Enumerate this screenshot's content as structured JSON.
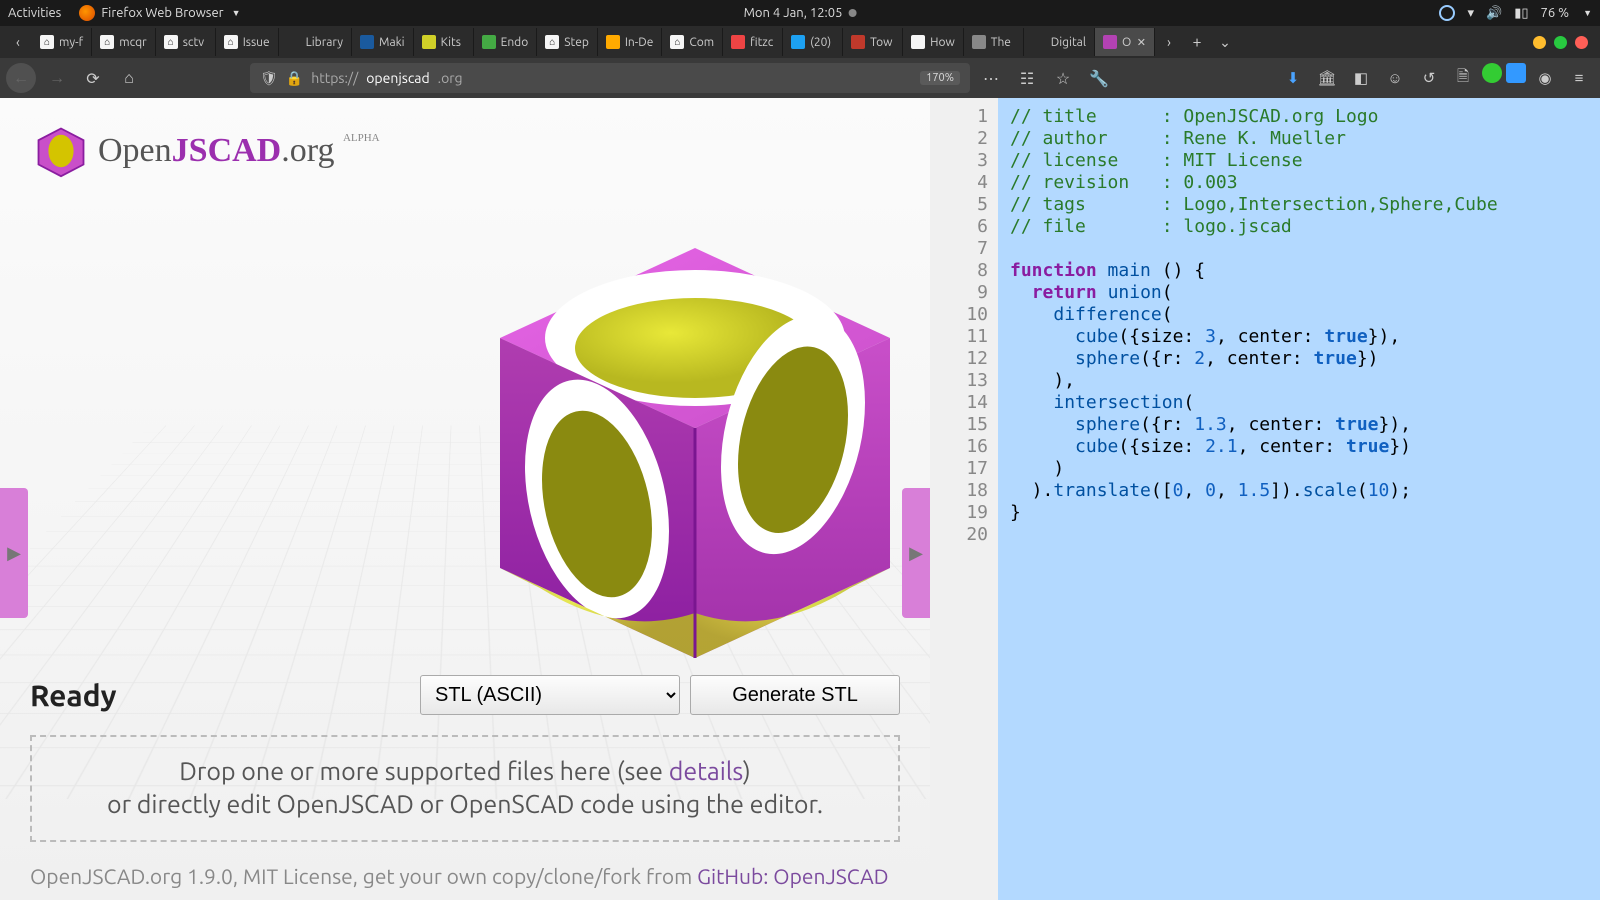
{
  "gnome": {
    "activities": "Activities",
    "app": "Firefox Web Browser",
    "clock": "Mon  4 Jan, 12:05",
    "battery": "76 %"
  },
  "tabs": {
    "items": [
      {
        "label": "my-f",
        "icon": "gh"
      },
      {
        "label": "mcqr",
        "icon": "gh"
      },
      {
        "label": "sctv",
        "icon": "gh"
      },
      {
        "label": "Issue",
        "icon": "gh"
      },
      {
        "label": "Library",
        "icon": ""
      },
      {
        "label": "Maki",
        "icon": "E"
      },
      {
        "label": "Kits",
        "icon": "k"
      },
      {
        "label": "Endo",
        "icon": "en"
      },
      {
        "label": "Step",
        "icon": "gh"
      },
      {
        "label": "In-De",
        "icon": "z"
      },
      {
        "label": "Com",
        "icon": "gh"
      },
      {
        "label": "fitzc",
        "icon": "p"
      },
      {
        "label": "(20)",
        "icon": "tw"
      },
      {
        "label": "Tow",
        "icon": "w"
      },
      {
        "label": "How",
        "icon": "q"
      },
      {
        "label": "The",
        "icon": "th"
      },
      {
        "label": "Digital",
        "icon": ""
      },
      {
        "label": "O",
        "icon": "oj",
        "active": true
      }
    ]
  },
  "address": {
    "url_prefix": "https://",
    "url_host": "openjscad",
    "url_tld": ".org",
    "zoom": "170%"
  },
  "app": {
    "logo_open": "Open",
    "logo_jscad_j": "JSCAD",
    "logo_org": ".org",
    "alpha": "ALPHA",
    "status": "Ready",
    "format": "STL (ASCII)",
    "generate": "Generate STL",
    "drop_l1a": "Drop one or more supported files here (see ",
    "drop_l1b": "details",
    "drop_l1c": ")",
    "drop_l2": "or directly edit OpenJSCAD or OpenSCAD code using the editor.",
    "footer_a": "OpenJSCAD.org 1.9.0, MIT License, get your own copy/clone/fork from ",
    "footer_b": "GitHub: OpenJSCAD"
  },
  "code": {
    "lines": [
      "// title      : OpenJSCAD.org Logo",
      "// author     : Rene K. Mueller",
      "// license    : MIT License",
      "// revision   : 0.003",
      "// tags       : Logo,Intersection,Sphere,Cube",
      "// file       : logo.jscad",
      "",
      "function main () {",
      "  return union(",
      "    difference(",
      "      cube({size: 3, center: true}),",
      "      sphere({r: 2, center: true})",
      "    ),",
      "    intersection(",
      "      sphere({r: 1.3, center: true}),",
      "      cube({size: 2.1, center: true})",
      "    )",
      "  ).translate([0, 0, 1.5]).scale(10);",
      "}",
      ""
    ]
  }
}
